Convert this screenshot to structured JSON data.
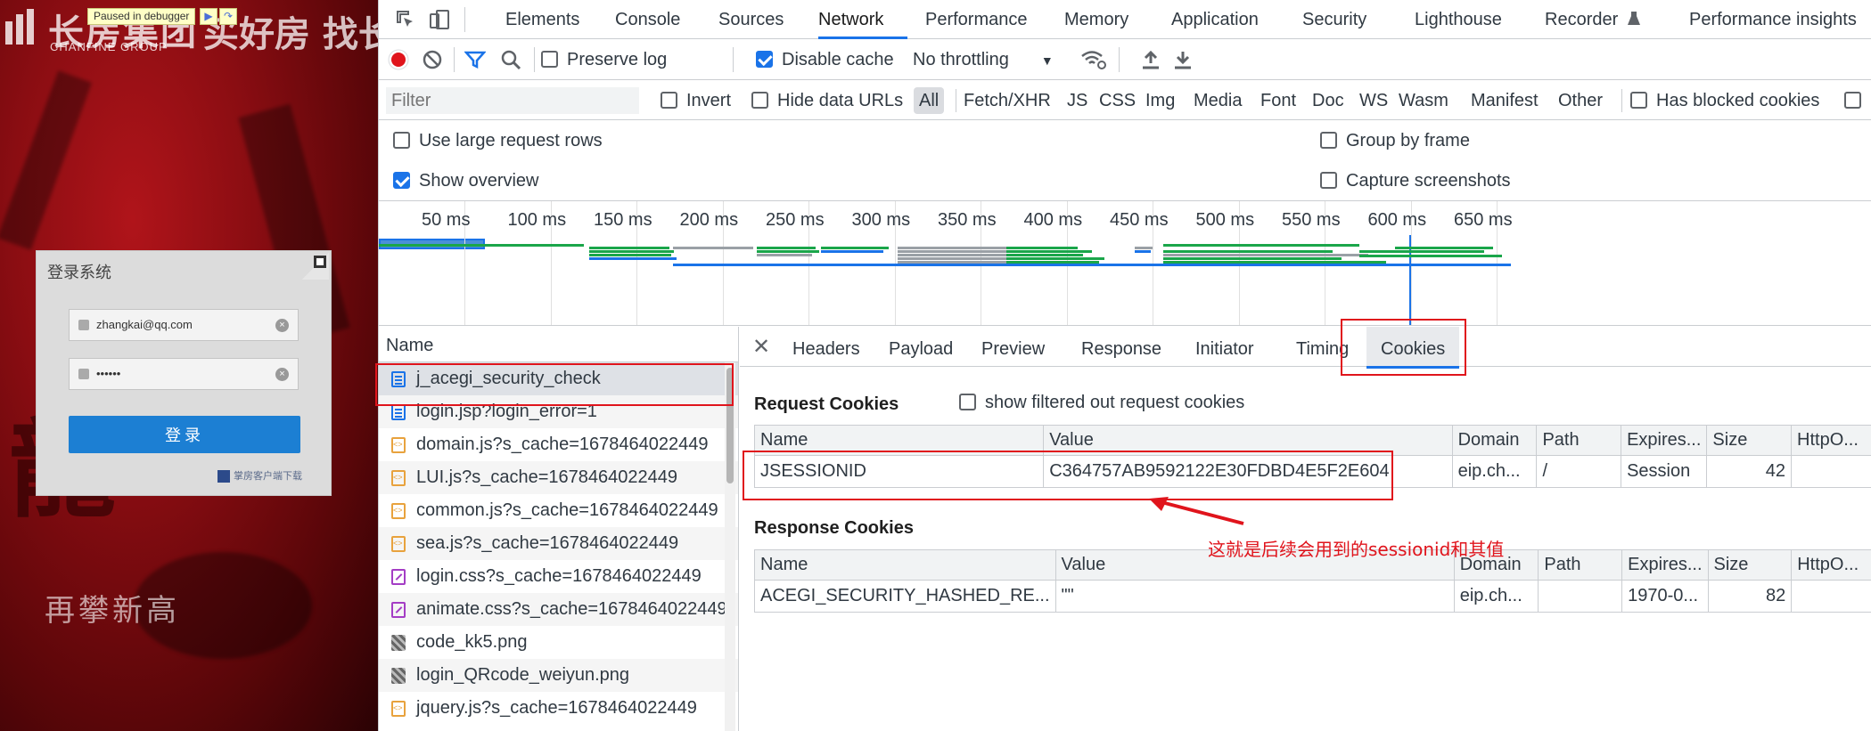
{
  "page": {
    "brand_cn": "长房集团",
    "brand_en": "CHANFINE GROUP",
    "slogan": "买好房 找长房",
    "debugger_badge": "Paused in debugger",
    "login": {
      "title": "登录系统",
      "username": "zhangkai@qq.com",
      "password": "••••••",
      "submit": "登录",
      "download": "掌房客户端下载"
    }
  },
  "devtools": {
    "tabs": [
      "Elements",
      "Console",
      "Sources",
      "Network",
      "Performance",
      "Memory",
      "Application",
      "Security",
      "Lighthouse",
      "Recorder",
      "Performance insights"
    ],
    "active_tab": "Network",
    "toolbar": {
      "preserve_log": "Preserve log",
      "disable_cache": "Disable cache",
      "throttling": "No throttling"
    },
    "filter": {
      "placeholder": "Filter",
      "invert": "Invert",
      "hide_data_urls": "Hide data URLs",
      "types": [
        "All",
        "Fetch/XHR",
        "JS",
        "CSS",
        "Img",
        "Media",
        "Font",
        "Doc",
        "WS",
        "Wasm",
        "Manifest",
        "Other"
      ],
      "blocked_cookies": "Has blocked cookies"
    },
    "settings": {
      "large_rows": "Use large request rows",
      "show_overview": "Show overview",
      "group_by_frame": "Group by frame",
      "capture_screenshots": "Capture screenshots"
    },
    "timeline_labels": [
      "50 ms",
      "100 ms",
      "150 ms",
      "200 ms",
      "250 ms",
      "300 ms",
      "350 ms",
      "400 ms",
      "450 ms",
      "500 ms",
      "550 ms",
      "600 ms",
      "650 ms"
    ],
    "requests": {
      "header": "Name",
      "rows": [
        {
          "name": "j_acegi_security_check",
          "type": "doc"
        },
        {
          "name": "login.jsp?login_error=1",
          "type": "doc"
        },
        {
          "name": "domain.js?s_cache=1678464022449",
          "type": "js"
        },
        {
          "name": "LUI.js?s_cache=1678464022449",
          "type": "js"
        },
        {
          "name": "common.js?s_cache=1678464022449",
          "type": "js"
        },
        {
          "name": "sea.js?s_cache=1678464022449",
          "type": "js"
        },
        {
          "name": "login.css?s_cache=1678464022449",
          "type": "css"
        },
        {
          "name": "animate.css?s_cache=1678464022449",
          "type": "css"
        },
        {
          "name": "code_kk5.png",
          "type": "img"
        },
        {
          "name": "login_QRcode_weiyun.png",
          "type": "img"
        },
        {
          "name": "jquery.js?s_cache=1678464022449",
          "type": "js"
        }
      ]
    },
    "detail_tabs": [
      "Headers",
      "Payload",
      "Preview",
      "Response",
      "Initiator",
      "Timing",
      "Cookies"
    ],
    "active_detail_tab": "Cookies",
    "request_cookies": {
      "title": "Request Cookies",
      "show_filtered": "show filtered out request cookies",
      "columns": [
        "Name",
        "Value",
        "Domain",
        "Path",
        "Expires...",
        "Size",
        "HttpO..."
      ],
      "rows": [
        {
          "name": "JSESSIONID",
          "value": "C364757AB9592122E30FDBD4E5F2E604",
          "domain": "eip.ch...",
          "path": "/",
          "expires": "Session",
          "size": "42",
          "httponly": ""
        }
      ]
    },
    "response_cookies": {
      "title": "Response Cookies",
      "columns": [
        "Name",
        "Value",
        "Domain",
        "Path",
        "Expires...",
        "Size",
        "HttpO..."
      ],
      "rows": [
        {
          "name": "ACEGI_SECURITY_HASHED_RE...",
          "value": "\"\"",
          "domain": "eip.ch...",
          "path": "",
          "expires": "1970-0...",
          "size": "82",
          "httponly": ""
        }
      ]
    }
  },
  "annotation": {
    "text": "这就是后续会用到的sessionid和其值",
    "color": "#e0141c"
  },
  "colors": {
    "accent": "#1a73e8",
    "record": "#e0141c",
    "waterfall_green": "#1aa64a",
    "waterfall_blue": "#1a73e8",
    "waterfall_gray": "#9aa0a6"
  }
}
